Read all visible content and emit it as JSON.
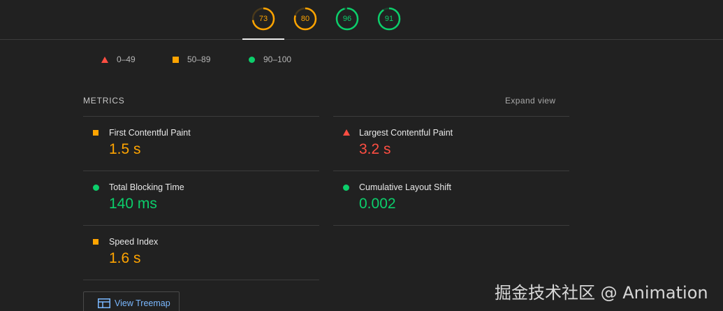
{
  "scores": [
    {
      "value": "73",
      "fraction": 0.73,
      "color": "#ffa400"
    },
    {
      "value": "80",
      "fraction": 0.8,
      "color": "#ffa400"
    },
    {
      "value": "96",
      "fraction": 0.96,
      "color": "#0cce6b"
    },
    {
      "value": "91",
      "fraction": 0.91,
      "color": "#0cce6b"
    }
  ],
  "legend": {
    "fail": "0–49",
    "average": "50–89",
    "pass": "90–100"
  },
  "metrics": {
    "header": "METRICS",
    "expand": "Expand view",
    "items": [
      {
        "title": "First Contentful Paint",
        "value": "1.5 s",
        "status": "average"
      },
      {
        "title": "Largest Contentful Paint",
        "value": "3.2 s",
        "status": "fail"
      },
      {
        "title": "Total Blocking Time",
        "value": "140 ms",
        "status": "pass"
      },
      {
        "title": "Cumulative Layout Shift",
        "value": "0.002",
        "status": "pass"
      },
      {
        "title": "Speed Index",
        "value": "1.6 s",
        "status": "average"
      }
    ]
  },
  "treemap": {
    "label": "View Treemap"
  },
  "watermark": "掘金技术社区 @ Animation",
  "colors": {
    "fail": "#ff4e42",
    "average": "#ffa400",
    "pass": "#0cce6b",
    "background": "#212121"
  }
}
